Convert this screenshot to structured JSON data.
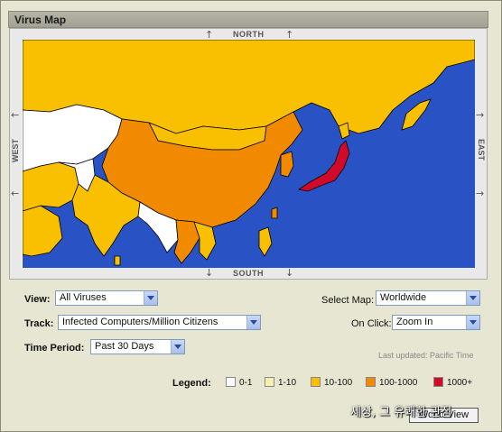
{
  "window": {
    "title": "Virus Map"
  },
  "map": {
    "north": "NORTH",
    "south": "SOUTH",
    "east": "EAST",
    "west": "WEST",
    "colors": {
      "ocean": "#2952c4",
      "level0": "#ffffff",
      "level1": "#f5f0b0",
      "level2": "#f8c000",
      "level3": "#f28a00",
      "level4": "#d10a2a"
    }
  },
  "controls": {
    "view_label": "View:",
    "view_value": "All Viruses",
    "track_label": "Track:",
    "track_value": "Infected Computers/Million Citizens",
    "period_label": "Time Period:",
    "period_value": "Past 30 Days",
    "select_map_label": "Select Map:",
    "select_map_value": "Worldwide",
    "onclick_label": "On Click:",
    "onclick_value": "Zoom In",
    "last_updated": "Last updated:  Pacific Time"
  },
  "legend": {
    "label": "Legend:",
    "items": [
      {
        "label": "0-1",
        "color": "#ffffff"
      },
      {
        "label": "1-10",
        "color": "#f5f0b0"
      },
      {
        "label": "10-100",
        "color": "#f8c000"
      },
      {
        "label": "100-1000",
        "color": "#f28a00"
      },
      {
        "label": "1000+",
        "color": "#d10a2a"
      }
    ]
  },
  "world_view_button": "World View",
  "overlay_text": "세상, 그 유쾌한 관점"
}
